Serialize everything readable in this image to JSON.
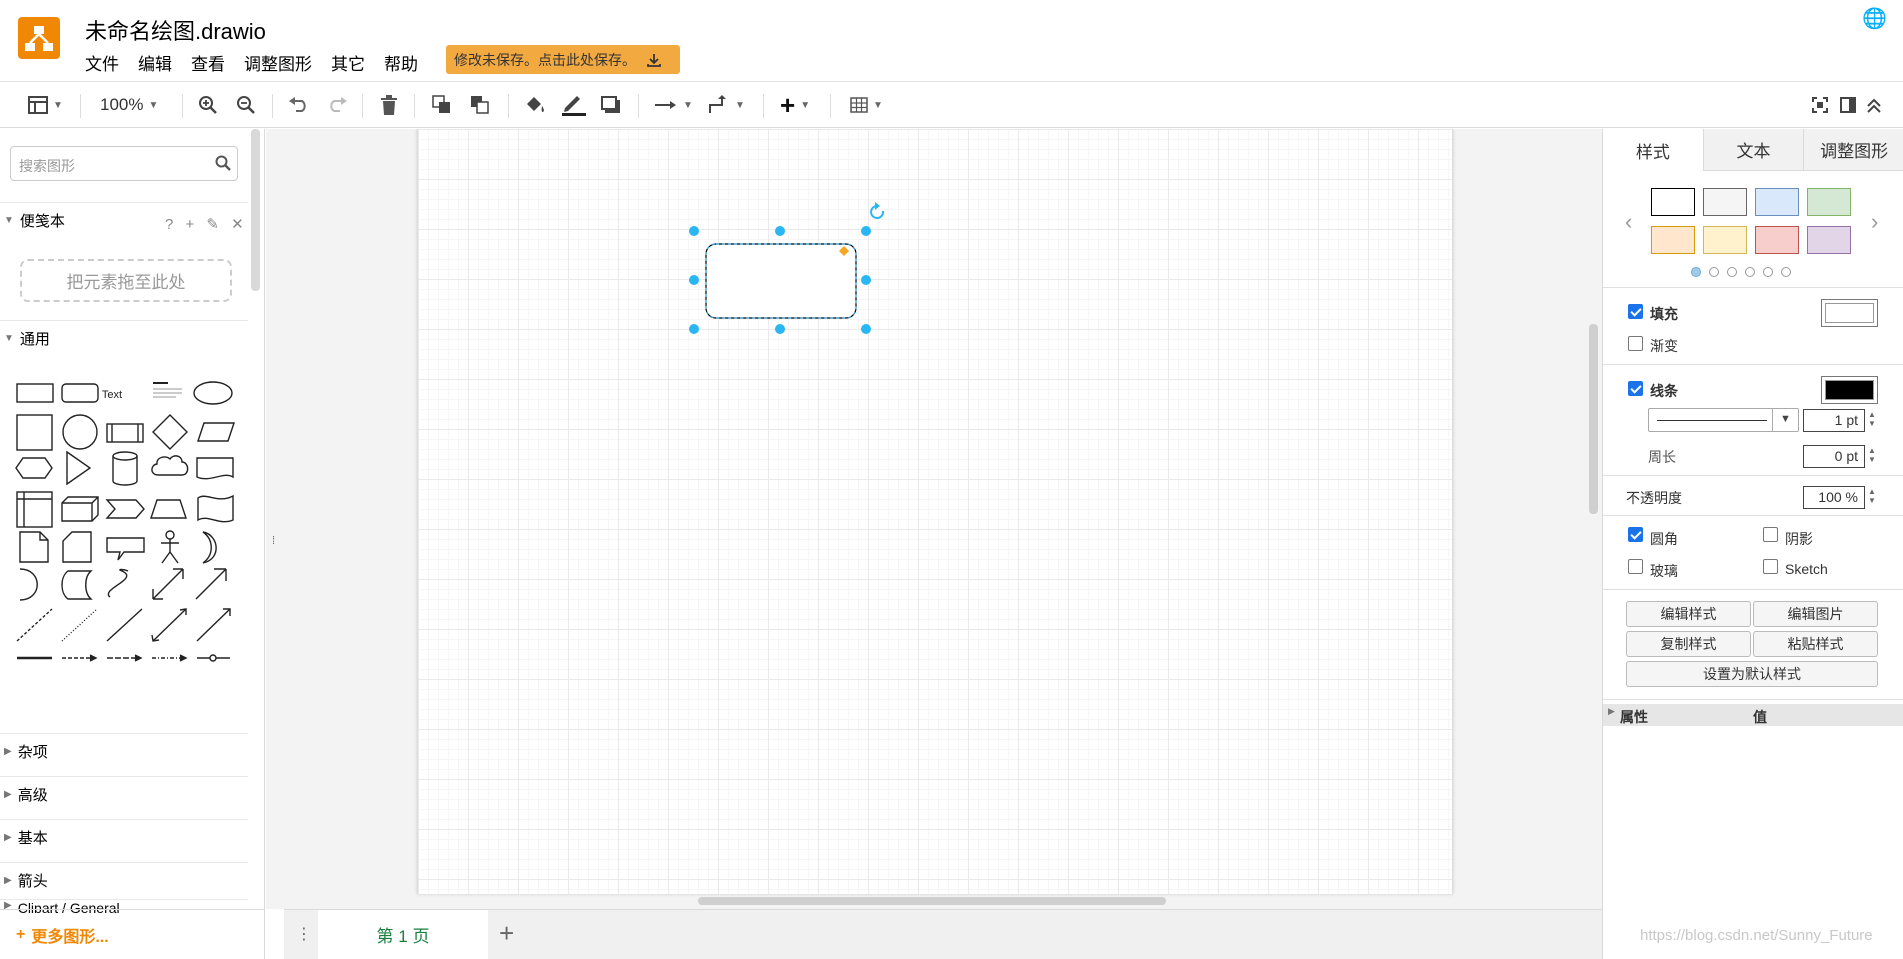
{
  "header": {
    "title": "未命名绘图.drawio",
    "menu": [
      "文件",
      "编辑",
      "查看",
      "调整图形",
      "其它",
      "帮助"
    ],
    "save_notice": "修改未保存。点击此处保存。"
  },
  "toolbar": {
    "zoom": "100%",
    "icons": [
      "format-panel-icon",
      "zoom-in-icon",
      "zoom-out-icon",
      "undo-icon",
      "redo-icon",
      "delete-icon",
      "to-front-icon",
      "to-back-icon",
      "fill-color-icon",
      "line-color-icon",
      "shadow-icon",
      "connection-icon",
      "waypoints-icon",
      "insert-icon",
      "table-icon",
      "fullscreen-icon",
      "toggle-panel-icon",
      "collapse-icon"
    ]
  },
  "sidebar": {
    "search_placeholder": "搜索图形",
    "scratchpad": {
      "title": "便笺本",
      "tools": "? + ✎ ✕",
      "drop_hint": "把元素拖至此处"
    },
    "general": {
      "title": "通用",
      "text_shape": "Text"
    },
    "sections": [
      "杂项",
      "高级",
      "基本",
      "箭头",
      "Clipart / General"
    ],
    "more_shapes": "更多图形..."
  },
  "pages": {
    "current": "第 1 页"
  },
  "format_panel": {
    "tabs": [
      "样式",
      "文本",
      "调整图形"
    ],
    "swatches": [
      "#ffffff",
      "#f5f5f5",
      "#dae8fc",
      "#d5e8d4",
      "#ffe6cc",
      "#fff2cc",
      "#f8cecc",
      "#e1d5e7"
    ],
    "swatch_borders": [
      "#000000",
      "#666666",
      "#6c8ebf",
      "#82b366",
      "#d79b00",
      "#d6b656",
      "#b85450",
      "#9673a6"
    ],
    "fill": {
      "label": "填充",
      "checked": true,
      "color": "#ffffff"
    },
    "gradient": {
      "label": "渐变",
      "checked": false
    },
    "line": {
      "label": "线条",
      "checked": true,
      "color": "#000000",
      "width": "1 pt"
    },
    "perimeter": {
      "label": "周长",
      "value": "0 pt"
    },
    "opacity": {
      "label": "不透明度",
      "value": "100 %"
    },
    "rounded": {
      "label": "圆角",
      "checked": true
    },
    "shadow": {
      "label": "阴影",
      "checked": false
    },
    "glass": {
      "label": "玻璃",
      "checked": false
    },
    "sketch": {
      "label": "Sketch",
      "checked": false
    },
    "buttons": {
      "edit_style": "编辑样式",
      "edit_image": "编辑图片",
      "copy_style": "复制样式",
      "paste_style": "粘贴样式",
      "set_default": "设置为默认样式"
    },
    "props": {
      "col1": "属性",
      "col2": "值"
    }
  },
  "watermark": "https://blog.csdn.net/Sunny_Future",
  "colors": {
    "accent": "#f08705",
    "selection": "#29b6f2",
    "page_tab": "#1a7e3e"
  }
}
